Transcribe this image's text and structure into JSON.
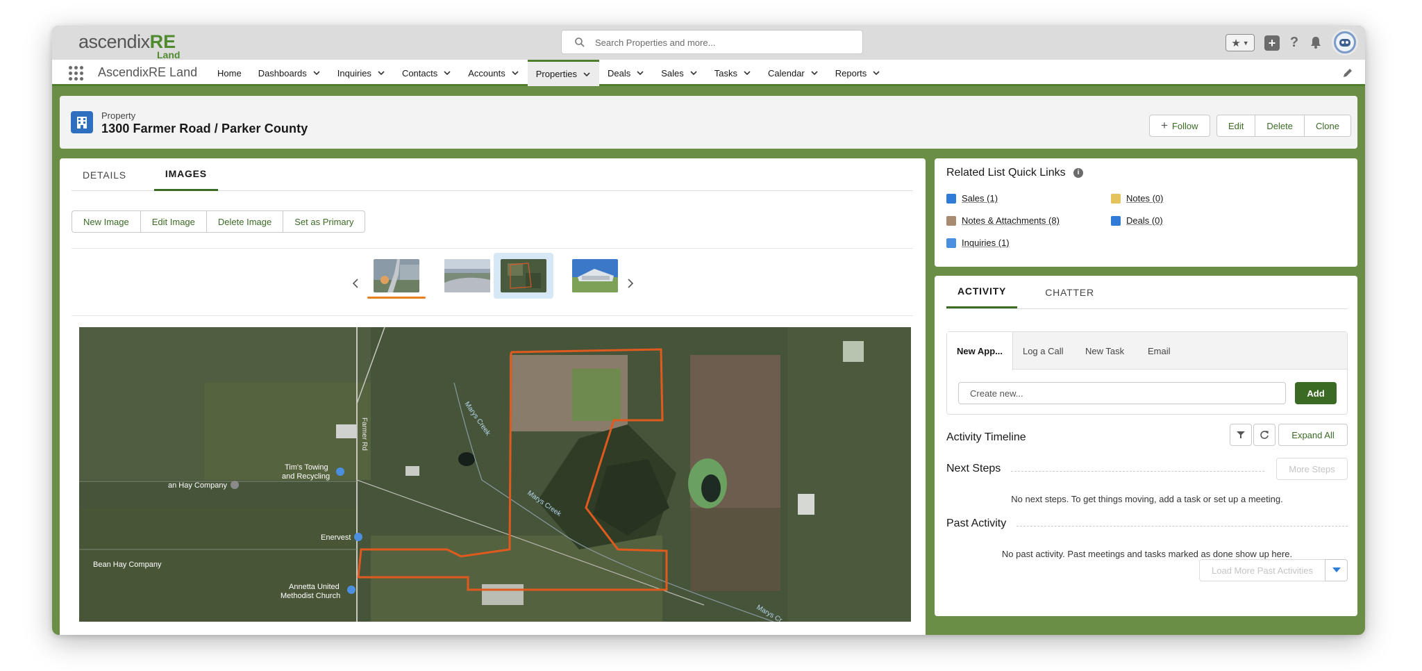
{
  "logo": {
    "part1": "ascendix",
    "part2": "RE",
    "part3": "Land"
  },
  "search": {
    "placeholder": "Search Properties and more..."
  },
  "app_name": "AscendixRE Land",
  "nav": {
    "items": [
      {
        "label": "Home",
        "chevron": false
      },
      {
        "label": "Dashboards",
        "chevron": true
      },
      {
        "label": "Inquiries",
        "chevron": true
      },
      {
        "label": "Contacts",
        "chevron": true
      },
      {
        "label": "Accounts",
        "chevron": true
      },
      {
        "label": "Properties",
        "chevron": true,
        "active": true
      },
      {
        "label": "Deals",
        "chevron": true
      },
      {
        "label": "Sales",
        "chevron": true
      },
      {
        "label": "Tasks",
        "chevron": true
      },
      {
        "label": "Calendar",
        "chevron": true
      },
      {
        "label": "Reports",
        "chevron": true
      }
    ]
  },
  "record": {
    "type": "Property",
    "title": "1300 Farmer Road / Parker County",
    "actions": {
      "follow": "Follow",
      "edit": "Edit",
      "delete": "Delete",
      "clone": "Clone"
    }
  },
  "detail_tabs": {
    "details": "DETAILS",
    "images": "IMAGES"
  },
  "image_actions": {
    "new": "New Image",
    "edit": "Edit Image",
    "delete": "Delete Image",
    "primary": "Set as Primary"
  },
  "map_labels": {
    "tims_towing": "Tim's Towing and Recycling",
    "hay_company": "an Hay Company",
    "enervest": "Enervest",
    "bean_hay": "Bean Hay Company",
    "annetta": "Annetta United Methodist Church",
    "farmer_rd": "Farmer Rd",
    "marys_creek_1": "Marys Creek",
    "marys_creek_2": "Marys Creek",
    "marys_creek_3": "Marys Cr"
  },
  "quick_links": {
    "title": "Related List Quick Links",
    "items": [
      {
        "label": "Sales (1)",
        "color": "#2f7bd6"
      },
      {
        "label": "Notes (0)",
        "color": "#e5c35c"
      },
      {
        "label": "Notes & Attachments (8)",
        "color": "#a98b72"
      },
      {
        "label": "Deals (0)",
        "color": "#2f7bd6"
      },
      {
        "label": "Inquiries (1)",
        "color": "#4a8fe0"
      }
    ]
  },
  "activity": {
    "tabs": {
      "activity": "ACTIVITY",
      "chatter": "CHATTER"
    },
    "publisher_tabs": [
      "New App...",
      "Log a Call",
      "New Task",
      "Email"
    ],
    "input_placeholder": "Create new...",
    "add_label": "Add",
    "timeline_title": "Activity Timeline",
    "expand_all": "Expand All",
    "next_steps": "Next Steps",
    "more_steps": "More Steps",
    "next_empty": "No next steps. To get things moving, add a task or set up a meeting.",
    "past_activity": "Past Activity",
    "past_empty": "No past activity. Past meetings and tasks marked as done show up here.",
    "load_more": "Load More Past Activities"
  }
}
